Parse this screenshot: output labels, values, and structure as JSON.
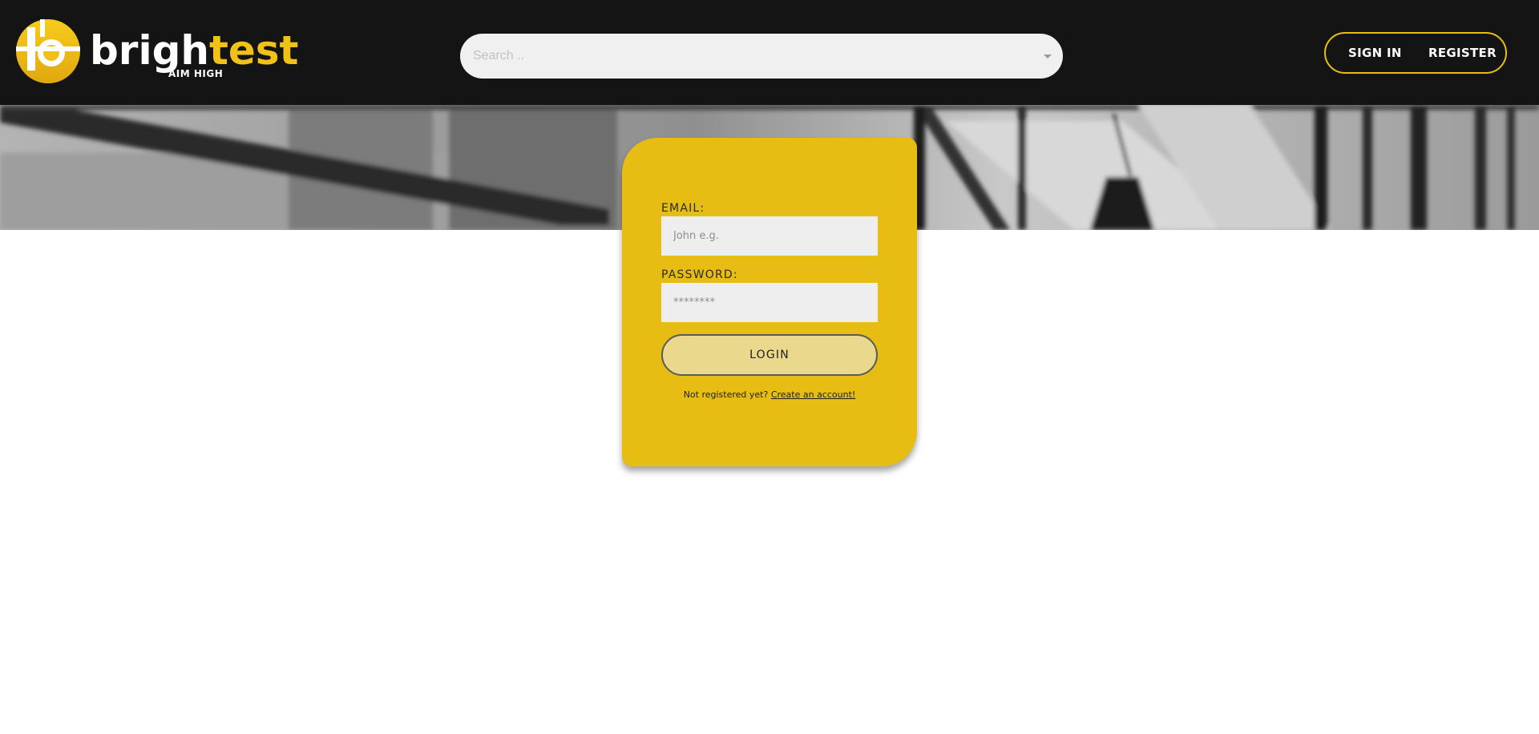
{
  "brand": {
    "name_part1": "brigh",
    "name_part2": "test",
    "tagline": "AIM HIGH",
    "logo_icon": "brightest-logo-icon"
  },
  "colors": {
    "accent": "#e8bd13",
    "header_bg": "#141414",
    "login_button_bg": "#ead98d"
  },
  "header": {
    "search": {
      "placeholder": "Search ..",
      "dropdown_icon": "caret-down-icon"
    },
    "auth": {
      "sign_in_label": "SIGN IN",
      "register_label": "REGISTER"
    }
  },
  "login": {
    "email_label": "EMAIL:",
    "email_placeholder": "John e.g.",
    "password_label": "PASSWORD:",
    "password_placeholder": "********",
    "login_button": "LOGIN",
    "not_registered_text": "Not registered yet?",
    "create_account_link": "Create an account!"
  }
}
